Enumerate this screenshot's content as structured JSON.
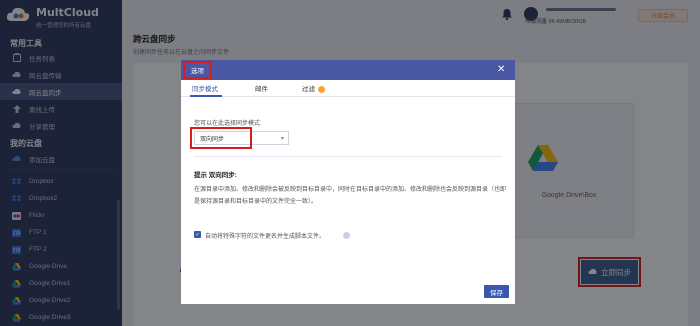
{
  "app": {
    "brand": "MultCloud",
    "slogan": "统一管理您的所有云盘"
  },
  "sidebar": {
    "section_tools": "常用工具",
    "section_drives": "我的云盘",
    "tools": [
      {
        "label": "任务列表",
        "icon": "clipboard-icon"
      },
      {
        "label": "跨云盘传输",
        "icon": "cloud-transfer-icon"
      },
      {
        "label": "跨云盘同步",
        "icon": "cloud-sync-icon",
        "active": true
      },
      {
        "label": "离线上传",
        "icon": "upload-icon"
      },
      {
        "label": "分享管理",
        "icon": "share-icon"
      }
    ],
    "drives": [
      {
        "label": "添加云盘",
        "icon": "add-cloud-icon"
      },
      {
        "label": "Dropbox",
        "icon": "dropbox-icon"
      },
      {
        "label": "Dropbox2",
        "icon": "dropbox-icon"
      },
      {
        "label": "Flickr",
        "icon": "flickr-icon"
      },
      {
        "label": "FTP 1",
        "icon": "ftp-icon"
      },
      {
        "label": "FTP 2",
        "icon": "ftp-icon"
      },
      {
        "label": "Google Drive",
        "icon": "google-drive-icon"
      },
      {
        "label": "Google Drive1",
        "icon": "google-drive-icon"
      },
      {
        "label": "Google Drive2",
        "icon": "google-drive-icon"
      },
      {
        "label": "Google Drive3",
        "icon": "google-drive-icon"
      }
    ]
  },
  "topbar": {
    "traffic": "传输流量 96.49MB/30GB",
    "upgrade": "升级会员"
  },
  "main": {
    "title": "跨云盘同步",
    "subtitle": "创建同步任务以在云盘之间同步文件",
    "target_drive": "Google Drive\\Box",
    "sync_button": "立即同步"
  },
  "modal": {
    "title": "选项",
    "tabs": [
      "同步模式",
      "邮件",
      "过滤"
    ],
    "hint": "您可以在此选择同步模式:",
    "mode_value": "双向同步",
    "tip_title": "提示  双向同步:",
    "tip_body": "在源目录中添加、修改和删除会被反映到目标目录中，同时在目标目录中的添加、修改和删除也会反映到源目录（也即是保持源目录和目标目录中的文件完全一致）。",
    "checkbox_label": "自动将特殊字符的文件更名并生成脚本文件。",
    "save": "保存"
  },
  "colors": {
    "sidebar_bg": "#2e3a5e",
    "modal_header": "#4a57a2",
    "accent": "#3a58b0",
    "highlight": "#d61e1e"
  }
}
